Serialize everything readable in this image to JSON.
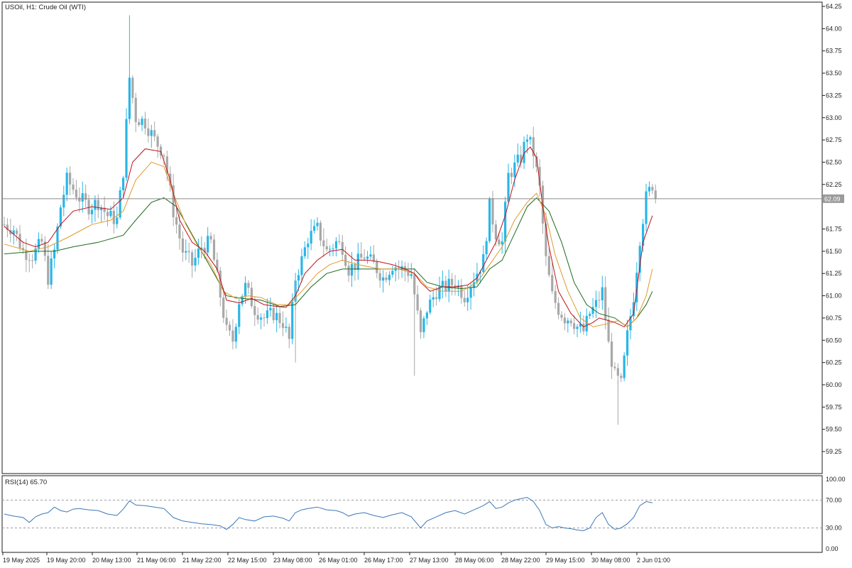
{
  "chart_data": {
    "type": "candlestick",
    "title": "USOil, H1:  Crude Oil (WTI)",
    "current_price_label": "62.09",
    "current_price": 62.09,
    "price_axis": {
      "ylim": [
        59.0,
        64.25
      ],
      "ticks": [
        "64.25",
        "64.00",
        "63.75",
        "63.50",
        "63.25",
        "63.00",
        "62.75",
        "62.50",
        "62.25",
        "62.00",
        "61.75",
        "61.50",
        "61.25",
        "61.00",
        "60.75",
        "60.50",
        "60.25",
        "60.00",
        "59.75",
        "59.50",
        "59.25"
      ]
    },
    "time_axis": {
      "ticks": [
        "19 May 2025",
        "19 May 20:00",
        "20 May 13:00",
        "21 May 06:00",
        "21 May 22:00",
        "22 May 15:00",
        "23 May 08:00",
        "26 May 01:00",
        "26 May 17:00",
        "27 May 13:00",
        "28 May 06:00",
        "28 May 22:00",
        "29 May 15:00",
        "30 May 08:00",
        "2 Jun 01:00"
      ]
    },
    "colors": {
      "bull": "#29b6e8",
      "bear": "#a8a8a8",
      "ma_fast": "#c0121b",
      "ma_mid": "#e09a2b",
      "ma_slow": "#1d6b1d",
      "rsi": "#3b78b8",
      "price_line": "#8a8a8a"
    },
    "price_path": [
      [
        0,
        61.8
      ],
      [
        3,
        61.75
      ],
      [
        6,
        61.5
      ],
      [
        9,
        61.45
      ],
      [
        12,
        61.6
      ],
      [
        14,
        61.2
      ],
      [
        16,
        61.5
      ],
      [
        18,
        62.0
      ],
      [
        20,
        62.3
      ],
      [
        22,
        62.2
      ],
      [
        24,
        62.1
      ],
      [
        27,
        62.0
      ],
      [
        30,
        62.05
      ],
      [
        33,
        61.9
      ],
      [
        36,
        61.85
      ],
      [
        38,
        62.4
      ],
      [
        40,
        63.45
      ],
      [
        42,
        63.0
      ],
      [
        45,
        62.95
      ],
      [
        48,
        62.75
      ],
      [
        51,
        62.6
      ],
      [
        54,
        61.95
      ],
      [
        57,
        61.5
      ],
      [
        60,
        61.35
      ],
      [
        63,
        61.55
      ],
      [
        66,
        61.6
      ],
      [
        69,
        61.0
      ],
      [
        71,
        60.6
      ],
      [
        73,
        60.5
      ],
      [
        75,
        60.95
      ],
      [
        77,
        61.1
      ],
      [
        80,
        60.85
      ],
      [
        83,
        60.75
      ],
      [
        86,
        60.8
      ],
      [
        89,
        60.7
      ],
      [
        91,
        60.5
      ],
      [
        93,
        61.2
      ],
      [
        95,
        61.4
      ],
      [
        97,
        61.65
      ],
      [
        100,
        61.75
      ],
      [
        103,
        61.5
      ],
      [
        106,
        61.6
      ],
      [
        108,
        61.55
      ],
      [
        110,
        61.3
      ],
      [
        112,
        61.35
      ],
      [
        115,
        61.45
      ],
      [
        118,
        61.35
      ],
      [
        121,
        61.2
      ],
      [
        124,
        61.35
      ],
      [
        127,
        61.3
      ],
      [
        130,
        61.25
      ],
      [
        133,
        60.55
      ],
      [
        135,
        60.85
      ],
      [
        138,
        61.05
      ],
      [
        141,
        61.1
      ],
      [
        144,
        61.15
      ],
      [
        147,
        61.0
      ],
      [
        150,
        61.2
      ],
      [
        153,
        61.4
      ],
      [
        155,
        62.0
      ],
      [
        157,
        61.7
      ],
      [
        159,
        61.6
      ],
      [
        161,
        62.35
      ],
      [
        163,
        62.45
      ],
      [
        165,
        62.55
      ],
      [
        167,
        62.8
      ],
      [
        169,
        62.6
      ],
      [
        171,
        62.2
      ],
      [
        173,
        61.4
      ],
      [
        175,
        61.0
      ],
      [
        177,
        60.85
      ],
      [
        179,
        60.75
      ],
      [
        181,
        60.75
      ],
      [
        183,
        60.65
      ],
      [
        185,
        60.6
      ],
      [
        187,
        60.8
      ],
      [
        189,
        60.9
      ],
      [
        191,
        61.05
      ],
      [
        193,
        60.45
      ],
      [
        195,
        60.1
      ],
      [
        197,
        60.0
      ],
      [
        199,
        60.55
      ],
      [
        201,
        61.0
      ],
      [
        203,
        61.65
      ],
      [
        205,
        62.1
      ],
      [
        207,
        62.25
      ],
      [
        208,
        62.09
      ]
    ],
    "ma_fast": [
      [
        0,
        61.78
      ],
      [
        6,
        61.6
      ],
      [
        10,
        61.55
      ],
      [
        14,
        61.6
      ],
      [
        18,
        61.8
      ],
      [
        22,
        61.95
      ],
      [
        28,
        62.0
      ],
      [
        34,
        61.97
      ],
      [
        38,
        62.1
      ],
      [
        41,
        62.5
      ],
      [
        45,
        62.65
      ],
      [
        50,
        62.62
      ],
      [
        53,
        62.3
      ],
      [
        56,
        61.85
      ],
      [
        60,
        61.6
      ],
      [
        64,
        61.5
      ],
      [
        68,
        61.3
      ],
      [
        71,
        60.95
      ],
      [
        75,
        60.92
      ],
      [
        79,
        60.97
      ],
      [
        83,
        60.9
      ],
      [
        87,
        60.88
      ],
      [
        90,
        60.87
      ],
      [
        93,
        61.0
      ],
      [
        96,
        61.25
      ],
      [
        100,
        61.4
      ],
      [
        104,
        61.5
      ],
      [
        108,
        61.52
      ],
      [
        112,
        61.4
      ],
      [
        116,
        61.4
      ],
      [
        120,
        61.38
      ],
      [
        124,
        61.35
      ],
      [
        128,
        61.3
      ],
      [
        131,
        61.25
      ],
      [
        133,
        61.15
      ],
      [
        136,
        61.05
      ],
      [
        140,
        61.1
      ],
      [
        144,
        61.1
      ],
      [
        148,
        61.12
      ],
      [
        151,
        61.2
      ],
      [
        154,
        61.4
      ],
      [
        157,
        61.6
      ],
      [
        160,
        61.9
      ],
      [
        163,
        62.3
      ],
      [
        166,
        62.6
      ],
      [
        168,
        62.67
      ],
      [
        170,
        62.55
      ],
      [
        172,
        62.0
      ],
      [
        174,
        61.55
      ],
      [
        177,
        61.05
      ],
      [
        181,
        60.8
      ],
      [
        185,
        60.65
      ],
      [
        188,
        60.7
      ],
      [
        190,
        60.75
      ],
      [
        192,
        60.73
      ],
      [
        195,
        60.7
      ],
      [
        198,
        60.65
      ],
      [
        201,
        60.8
      ],
      [
        204,
        61.6
      ],
      [
        207,
        61.9
      ]
    ],
    "ma_mid": [
      [
        0,
        61.58
      ],
      [
        8,
        61.5
      ],
      [
        14,
        61.55
      ],
      [
        20,
        61.65
      ],
      [
        28,
        61.8
      ],
      [
        34,
        61.85
      ],
      [
        38,
        61.95
      ],
      [
        42,
        62.3
      ],
      [
        47,
        62.5
      ],
      [
        51,
        62.45
      ],
      [
        54,
        62.15
      ],
      [
        58,
        61.8
      ],
      [
        62,
        61.55
      ],
      [
        66,
        61.35
      ],
      [
        70,
        61.05
      ],
      [
        74,
        60.97
      ],
      [
        78,
        61.0
      ],
      [
        82,
        60.98
      ],
      [
        87,
        60.9
      ],
      [
        91,
        60.9
      ],
      [
        95,
        61.05
      ],
      [
        100,
        61.25
      ],
      [
        104,
        61.35
      ],
      [
        108,
        61.4
      ],
      [
        113,
        61.35
      ],
      [
        120,
        61.3
      ],
      [
        126,
        61.3
      ],
      [
        131,
        61.25
      ],
      [
        135,
        61.1
      ],
      [
        140,
        61.05
      ],
      [
        146,
        61.05
      ],
      [
        151,
        61.15
      ],
      [
        155,
        61.35
      ],
      [
        159,
        61.55
      ],
      [
        163,
        61.85
      ],
      [
        167,
        62.05
      ],
      [
        170,
        62.15
      ],
      [
        173,
        61.9
      ],
      [
        176,
        61.45
      ],
      [
        180,
        61.05
      ],
      [
        184,
        60.75
      ],
      [
        188,
        60.65
      ],
      [
        192,
        60.68
      ],
      [
        196,
        60.72
      ],
      [
        199,
        60.65
      ],
      [
        202,
        60.75
      ],
      [
        205,
        61.0
      ],
      [
        207,
        61.3
      ]
    ],
    "ma_slow": [
      [
        0,
        61.47
      ],
      [
        10,
        61.5
      ],
      [
        16,
        61.5
      ],
      [
        22,
        61.55
      ],
      [
        30,
        61.6
      ],
      [
        38,
        61.68
      ],
      [
        42,
        61.85
      ],
      [
        47,
        62.05
      ],
      [
        51,
        62.1
      ],
      [
        55,
        62.0
      ],
      [
        59,
        61.75
      ],
      [
        63,
        61.5
      ],
      [
        67,
        61.25
      ],
      [
        71,
        61.0
      ],
      [
        76,
        60.97
      ],
      [
        82,
        60.95
      ],
      [
        88,
        60.88
      ],
      [
        93,
        60.9
      ],
      [
        98,
        61.1
      ],
      [
        103,
        61.25
      ],
      [
        108,
        61.3
      ],
      [
        114,
        61.3
      ],
      [
        120,
        61.3
      ],
      [
        126,
        61.3
      ],
      [
        131,
        61.3
      ],
      [
        135,
        61.15
      ],
      [
        140,
        61.1
      ],
      [
        146,
        61.08
      ],
      [
        151,
        61.1
      ],
      [
        155,
        61.3
      ],
      [
        159,
        61.4
      ],
      [
        163,
        61.7
      ],
      [
        167,
        62.0
      ],
      [
        170,
        62.1
      ],
      [
        174,
        61.95
      ],
      [
        178,
        61.6
      ],
      [
        182,
        61.15
      ],
      [
        186,
        60.9
      ],
      [
        190,
        60.8
      ],
      [
        195,
        60.75
      ],
      [
        199,
        60.65
      ],
      [
        202,
        60.75
      ],
      [
        205,
        60.9
      ],
      [
        207,
        61.05
      ]
    ],
    "rsi": {
      "label": "RSI(14) 65.70",
      "ylim": [
        0,
        100
      ],
      "levels": [
        30,
        70
      ],
      "ticks": [
        "100.00",
        "70.00",
        "30.00",
        "0.00"
      ],
      "values": [
        [
          0,
          50
        ],
        [
          3,
          47
        ],
        [
          6,
          45
        ],
        [
          8,
          38
        ],
        [
          10,
          46
        ],
        [
          12,
          50
        ],
        [
          14,
          52
        ],
        [
          16,
          60
        ],
        [
          18,
          55
        ],
        [
          20,
          53
        ],
        [
          22,
          57
        ],
        [
          24,
          58
        ],
        [
          27,
          56
        ],
        [
          30,
          55
        ],
        [
          33,
          50
        ],
        [
          36,
          48
        ],
        [
          38,
          57
        ],
        [
          40,
          69
        ],
        [
          42,
          63
        ],
        [
          45,
          62
        ],
        [
          48,
          60
        ],
        [
          51,
          58
        ],
        [
          54,
          45
        ],
        [
          57,
          40
        ],
        [
          60,
          38
        ],
        [
          63,
          36
        ],
        [
          66,
          35
        ],
        [
          69,
          33
        ],
        [
          71,
          28
        ],
        [
          73,
          35
        ],
        [
          75,
          45
        ],
        [
          77,
          42
        ],
        [
          80,
          40
        ],
        [
          83,
          46
        ],
        [
          86,
          47
        ],
        [
          89,
          44
        ],
        [
          91,
          40
        ],
        [
          93,
          52
        ],
        [
          95,
          56
        ],
        [
          97,
          58
        ],
        [
          100,
          60
        ],
        [
          103,
          56
        ],
        [
          106,
          55
        ],
        [
          108,
          52
        ],
        [
          110,
          47
        ],
        [
          112,
          50
        ],
        [
          115,
          52
        ],
        [
          118,
          48
        ],
        [
          121,
          45
        ],
        [
          124,
          49
        ],
        [
          127,
          52
        ],
        [
          130,
          46
        ],
        [
          133,
          30
        ],
        [
          135,
          40
        ],
        [
          138,
          46
        ],
        [
          141,
          52
        ],
        [
          144,
          55
        ],
        [
          147,
          50
        ],
        [
          150,
          56
        ],
        [
          153,
          62
        ],
        [
          155,
          68
        ],
        [
          157,
          58
        ],
        [
          159,
          60
        ],
        [
          161,
          66
        ],
        [
          163,
          70
        ],
        [
          165,
          72
        ],
        [
          167,
          74
        ],
        [
          169,
          68
        ],
        [
          171,
          55
        ],
        [
          173,
          35
        ],
        [
          175,
          30
        ],
        [
          177,
          32
        ],
        [
          179,
          30
        ],
        [
          181,
          29
        ],
        [
          183,
          27
        ],
        [
          185,
          26
        ],
        [
          187,
          30
        ],
        [
          189,
          45
        ],
        [
          191,
          52
        ],
        [
          193,
          35
        ],
        [
          195,
          28
        ],
        [
          197,
          30
        ],
        [
          199,
          36
        ],
        [
          201,
          45
        ],
        [
          203,
          62
        ],
        [
          205,
          68
        ],
        [
          207,
          66
        ]
      ]
    }
  }
}
